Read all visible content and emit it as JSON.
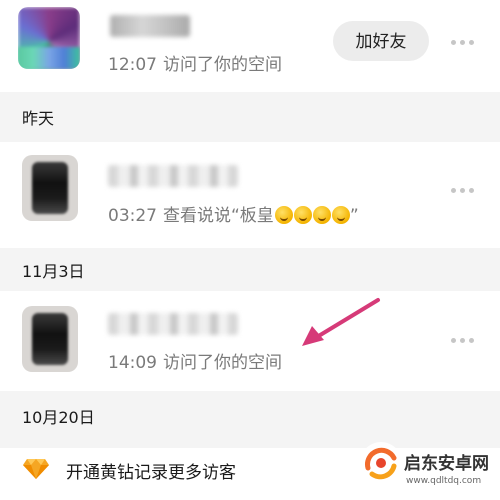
{
  "visitors": [
    {
      "time": "12:07",
      "action": "访问了你的空间",
      "button_label": "加好友"
    },
    {
      "time": "03:27",
      "action": "查看说说“板皇",
      "action_suffix": "”",
      "emoji_count": 4
    },
    {
      "time": "14:09",
      "action": "访问了你的空间"
    }
  ],
  "date_groups": [
    "昨天",
    "11月3日",
    "10月20日"
  ],
  "vip_banner": {
    "text": "开通黄钻记录更多访客",
    "icon": "diamond-icon"
  },
  "watermark": {
    "title": "启东安卓网",
    "url": "www.qdltdq.com"
  },
  "colors": {
    "accent_arrow": "#d63a78",
    "secondary_text": "#7a7a7a",
    "divider_bg": "#f4f4f4",
    "vip_gold": "#f5a623"
  }
}
